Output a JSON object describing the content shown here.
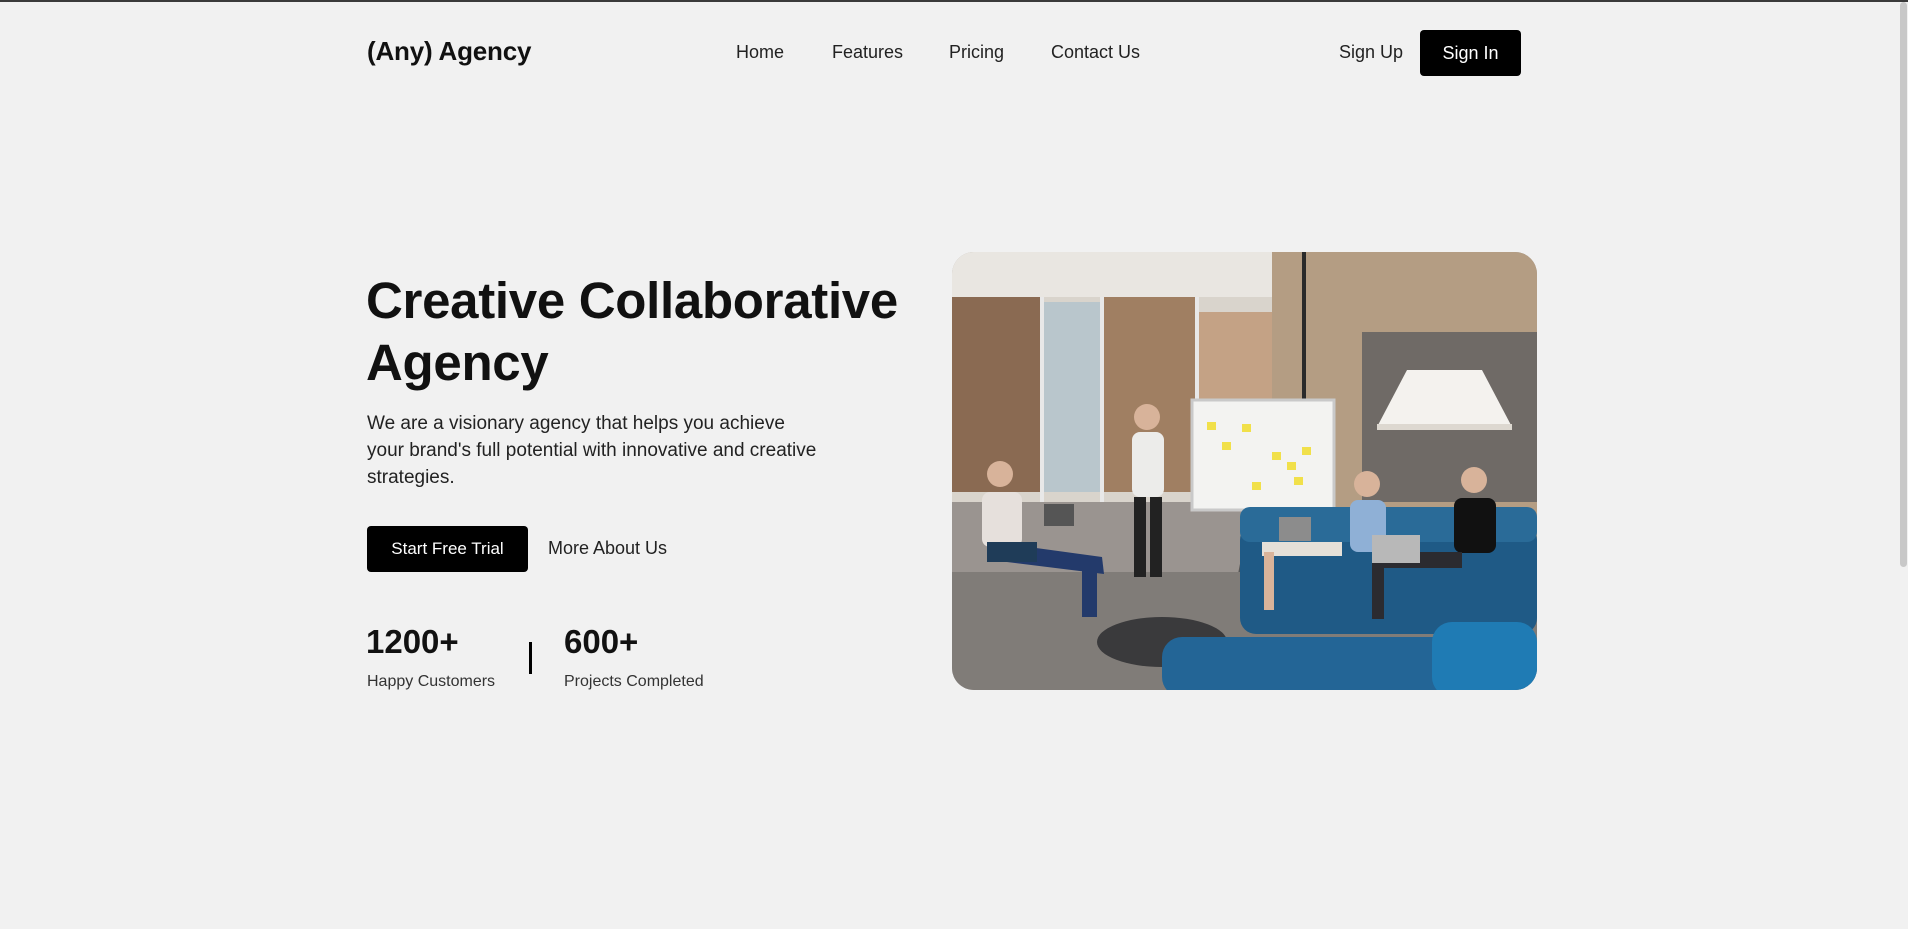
{
  "header": {
    "logo": "(Any) Agency",
    "nav": [
      {
        "label": "Home"
      },
      {
        "label": "Features"
      },
      {
        "label": "Pricing"
      },
      {
        "label": "Contact Us"
      }
    ],
    "signup_label": "Sign Up",
    "signin_label": "Sign In"
  },
  "hero": {
    "title_line1": "Creative Collaborative",
    "title_line2": "Agency",
    "description": "We are a visionary agency that helps you achieve your brand's full potential with innovative and creative strategies.",
    "primary_cta": "Start Free Trial",
    "secondary_cta": "More About Us",
    "stats": [
      {
        "value": "1200+",
        "label": "Happy Customers"
      },
      {
        "value": "600+",
        "label": "Projects Completed"
      }
    ]
  },
  "colors": {
    "background": "#f1f1f1",
    "button": "#000000",
    "text": "#111111"
  }
}
